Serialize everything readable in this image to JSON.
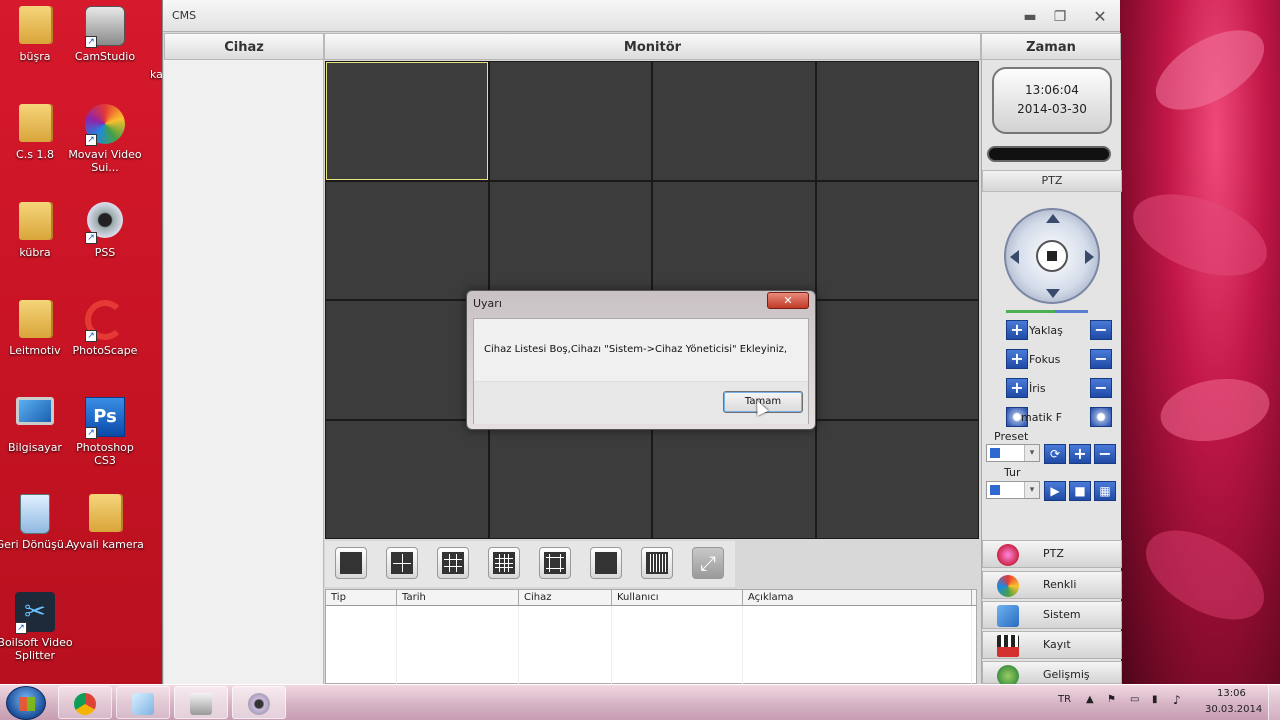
{
  "desktop": {
    "icons": [
      {
        "label": "büşra",
        "icon": "folder-icon"
      },
      {
        "label": "CamStudio",
        "icon": "camstudio-icon"
      },
      {
        "label": "C.s 1.8",
        "icon": "folder-icon"
      },
      {
        "label": "Movavi Video Sui...",
        "icon": "movavi-icon"
      },
      {
        "label": "kübra",
        "icon": "folder-icon"
      },
      {
        "label": "PSS",
        "icon": "webcam-icon"
      },
      {
        "label": "Leitmotiv",
        "icon": "folder-icon"
      },
      {
        "label": "PhotoScape",
        "icon": "photoscape-icon"
      },
      {
        "label": "Bilgisayar",
        "icon": "computer-icon"
      },
      {
        "label": "Photoshop CS3",
        "icon": "photoshop-icon"
      },
      {
        "label": "Geri Dönüşü...",
        "icon": "recycle-bin-icon"
      },
      {
        "label": "Ayvali kamera",
        "icon": "folder-icon"
      },
      {
        "label": "Boilsoft Video Splitter",
        "icon": "scissors-icon"
      }
    ],
    "partial_label": "ka"
  },
  "window": {
    "title": "CMS",
    "controls": {
      "minimize": "▬",
      "maximize": "❐",
      "close": "✕"
    }
  },
  "columns": {
    "device": "Cihaz",
    "monitor": "Monitör",
    "time": "Zaman"
  },
  "clock": {
    "time": "13:06:04",
    "date": "2014-03-30"
  },
  "ptz": {
    "header": "PTZ",
    "controls": [
      {
        "label": "Yaklaş"
      },
      {
        "label": "Fokus"
      },
      {
        "label": "İris"
      },
      {
        "label": "matik F"
      }
    ],
    "preset_label": "Preset",
    "tour_label": "Tur"
  },
  "menu": [
    {
      "label": "PTZ",
      "icon": "ptz-icon"
    },
    {
      "label": "Renkli",
      "icon": "color-icon"
    },
    {
      "label": "Sistem",
      "icon": "system-icon"
    },
    {
      "label": "Kayıt",
      "icon": "record-icon"
    },
    {
      "label": "Gelişmiş",
      "icon": "advanced-icon"
    }
  ],
  "layouts": [
    "1",
    "4",
    "9",
    "16",
    "25",
    "36",
    "64",
    "fullscreen"
  ],
  "log": {
    "columns": [
      "Tip",
      "Tarih",
      "Cihaz",
      "Kullanıcı",
      "Açıklama"
    ]
  },
  "dialog": {
    "title": "Uyarı",
    "close": "✕",
    "message": "Cihaz Listesi Boş,Cihazı \"Sistem->Cihaz Yöneticisi\" Ekleyiniz,",
    "ok": "Tamam"
  },
  "taskbar": {
    "apps": [
      "chrome-icon",
      "notepad-icon",
      "cms-icon",
      "pss-icon"
    ],
    "language": "TR",
    "time": "13:06",
    "date": "30.03.2014"
  }
}
